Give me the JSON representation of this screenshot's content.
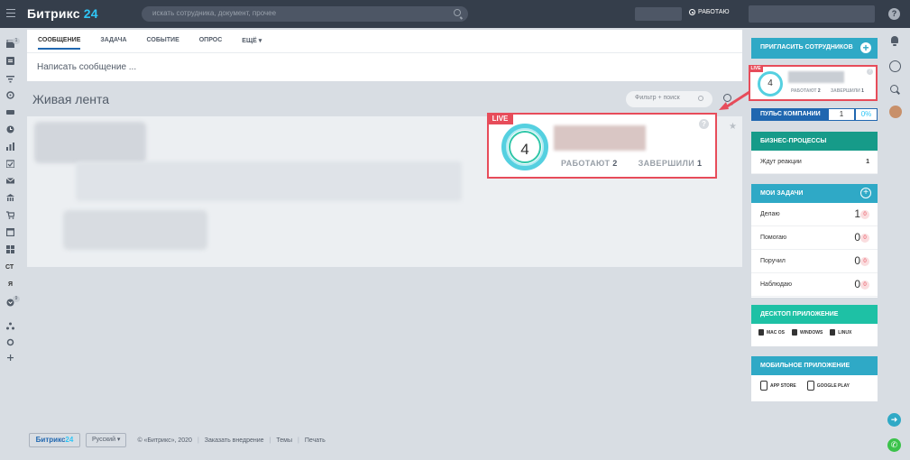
{
  "header": {
    "logo_main": "Битрикс",
    "logo_num": "24",
    "search_placeholder": "искать сотрудника, документ, прочее",
    "work_status": "РАБОТАЮ",
    "help": "?"
  },
  "left_bar": {
    "badges": [
      "1",
      "9"
    ],
    "text_items": [
      "СТ",
      "Я"
    ]
  },
  "post_form": {
    "tabs": [
      "СООБЩЕНИЕ",
      "ЗАДАЧА",
      "СОБЫТИЕ",
      "ОПРОС",
      "ЕЩЁ ▾"
    ],
    "placeholder": "Написать сообщение ..."
  },
  "feed": {
    "title": "Живая лента",
    "filter_placeholder": "Фильтр + поиск"
  },
  "pulse_callout": {
    "live": "LIVE",
    "help": "?",
    "count": "4",
    "working_label": "РАБОТАЮТ",
    "working_value": "2",
    "done_label": "ЗАВЕРШИЛИ",
    "done_value": "1"
  },
  "right_panel": {
    "invite": "ПРИГЛАСИТЬ СОТРУДНИКОВ",
    "pulse": {
      "live": "LIVE",
      "count": "4",
      "working_label": "РАБОТАЮТ",
      "working_value": "2",
      "done_label": "ЗАВЕРШИЛИ",
      "done_value": "1"
    },
    "company_pulse": {
      "label": "ПУЛЬС КОМПАНИИ",
      "value": "1",
      "percent": "0%"
    },
    "business_processes": {
      "title": "БИЗНЕС-ПРОЦЕССЫ",
      "row_label": "Ждут реакции",
      "row_value": "1"
    },
    "my_tasks": {
      "title": "МОИ ЗАДАЧИ",
      "rows": [
        {
          "label": "Делаю",
          "count": "1",
          "badge": "0"
        },
        {
          "label": "Помогаю",
          "count": "0",
          "badge": "0"
        },
        {
          "label": "Поручил",
          "count": "0",
          "badge": "0"
        },
        {
          "label": "Наблюдаю",
          "count": "0",
          "badge": "0"
        }
      ]
    },
    "desktop_app": {
      "title": "ДЕСКТОП ПРИЛОЖЕНИЕ",
      "os": [
        "MAC OS",
        "WINDOWS",
        "LINUX"
      ]
    },
    "mobile_app": {
      "title": "МОБИЛЬНОЕ ПРИЛОЖЕНИЕ",
      "stores": [
        "APP STORE",
        "GOOGLE PLAY"
      ]
    }
  },
  "footer": {
    "logo_main": "Битрикс",
    "logo_num": "24",
    "language": "Русский ▾",
    "copyright": "© «Битрикс», 2020",
    "links": [
      "Заказать внедрение",
      "Темы",
      "Печать"
    ]
  },
  "colors": {
    "header_bg": "#353e4b",
    "accent_blue": "#2067b0",
    "accent_cyan": "#2fc6f6",
    "live_red": "#e74c5a",
    "teal": "#169b89"
  }
}
